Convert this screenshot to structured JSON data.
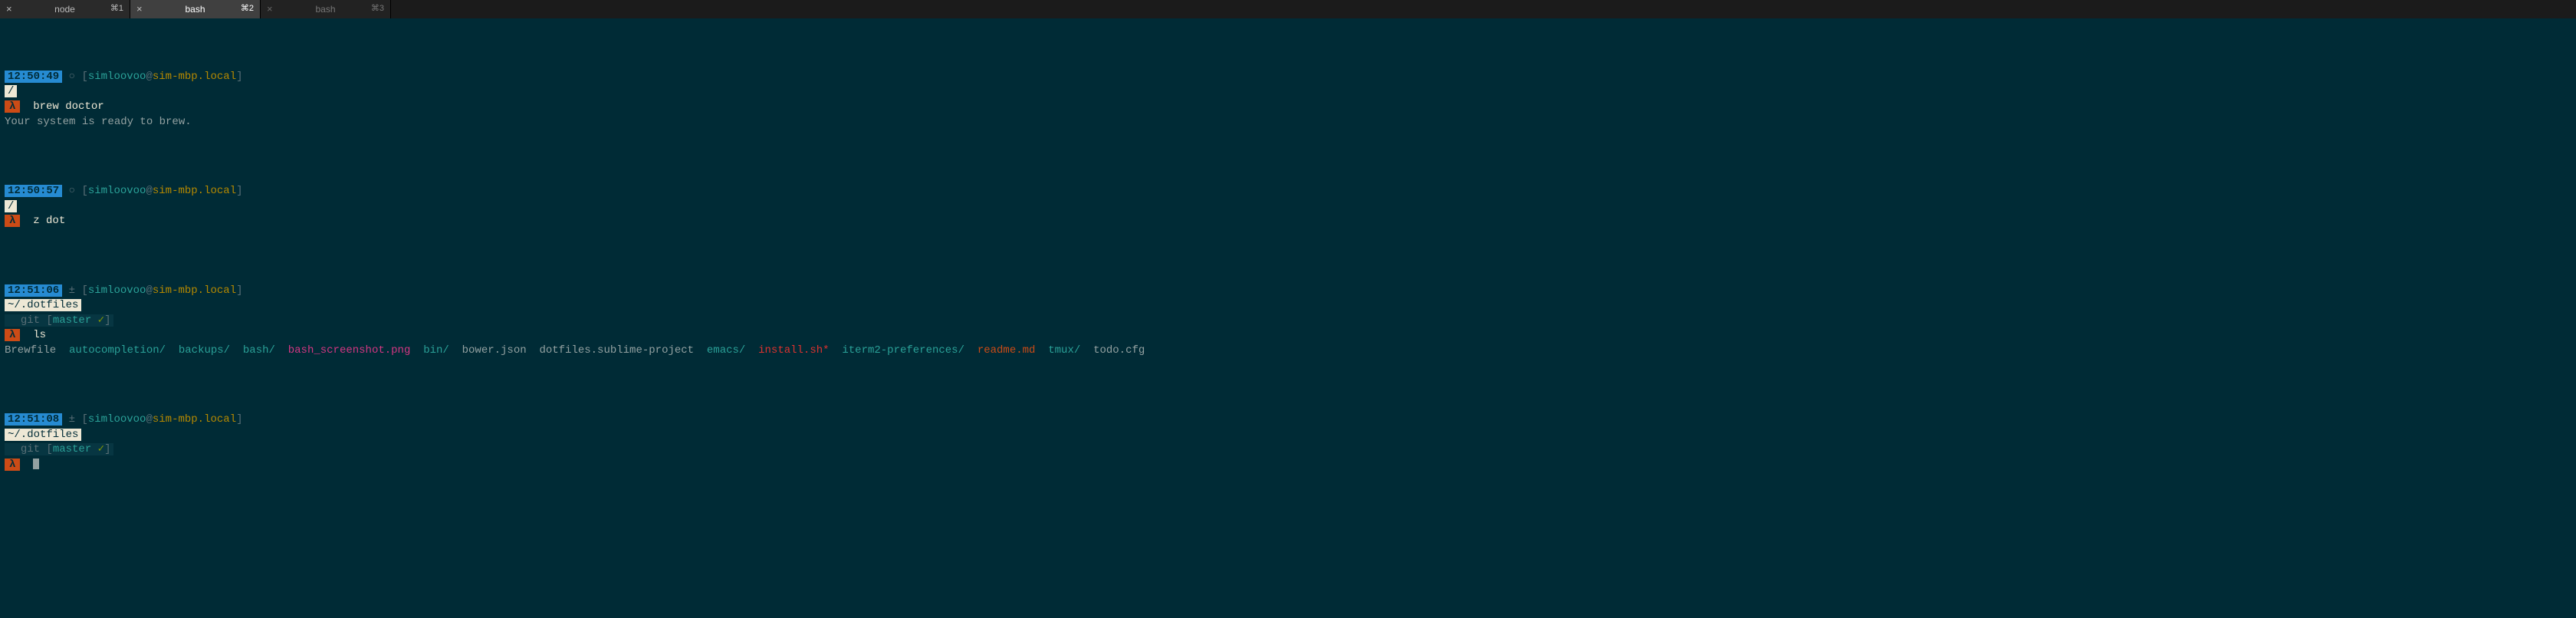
{
  "tabs": [
    {
      "title": "node",
      "shortcut": "⌘1",
      "close": "×",
      "state": "inactive"
    },
    {
      "title": "bash",
      "shortcut": "⌘2",
      "close": "×",
      "state": "active"
    },
    {
      "title": "bash",
      "shortcut": "⌘3",
      "close": "×",
      "state": "dim"
    }
  ],
  "user": "simloovoo",
  "host": "sim-mbp.local",
  "sep_at": "@",
  "bracket_open": "[",
  "bracket_close": "]",
  "lambda": "λ",
  "b1": {
    "time": "12:50:49",
    "sym": " ○ ",
    "path": "/",
    "cmd": "brew doctor",
    "output": "Your system is ready to brew."
  },
  "b2": {
    "time": "12:50:57",
    "sym": " ○ ",
    "path": "/",
    "cmd": "z dot"
  },
  "b3": {
    "time": "12:51:06",
    "sym": " ± ",
    "path": "~/.dotfiles",
    "git_label": "git ",
    "git_bo": "[",
    "git_branch": "master ",
    "git_check": "✓",
    "git_bc": "]",
    "cmd": "ls"
  },
  "ls": {
    "i0": "Brewfile",
    "i1": "autocompletion/",
    "i2": "backups/",
    "i3": "bash/",
    "i4": "bash_screenshot.png",
    "i5": "bin/",
    "i6": "bower.json",
    "i7": "dotfiles.sublime-project",
    "i8": "emacs/",
    "i9": "install.sh*",
    "i10": "iterm2-preferences/",
    "i11": "readme.md",
    "i12": "tmux/",
    "i13": "todo.cfg"
  },
  "b4": {
    "time": "12:51:08",
    "sym": " ± ",
    "path": "~/.dotfiles",
    "git_label": "git ",
    "git_bo": "[",
    "git_branch": "master ",
    "git_check": "✓",
    "git_bc": "]"
  }
}
